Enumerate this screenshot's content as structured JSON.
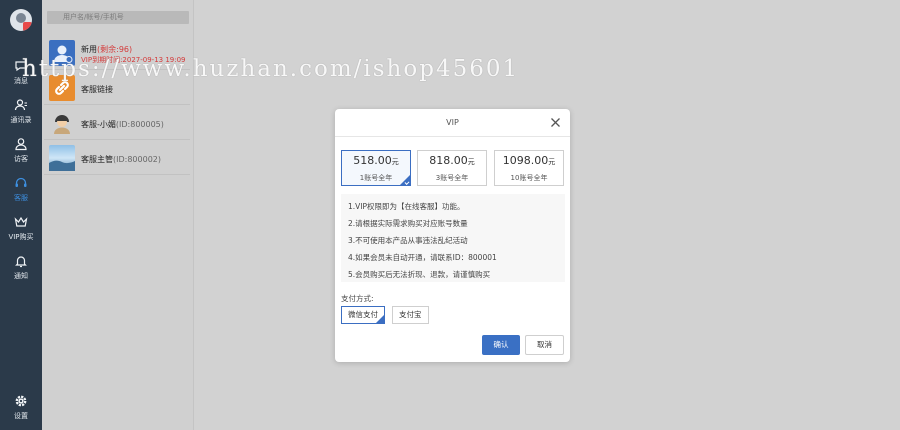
{
  "nav": {
    "items": [
      {
        "label": "消息",
        "icon": "chat-icon"
      },
      {
        "label": "通讯录",
        "icon": "contacts-icon"
      },
      {
        "label": "访客",
        "icon": "visitor-icon"
      },
      {
        "label": "客服",
        "icon": "headset-icon"
      },
      {
        "label": "VIP购买",
        "icon": "crown-icon"
      },
      {
        "label": "通知",
        "icon": "bell-icon"
      }
    ],
    "settings_label": "设置",
    "active_color": "#3d8fe0"
  },
  "search": {
    "placeholder": "用户名/帐号/手机号"
  },
  "contacts": [
    {
      "name": "新用",
      "name_extra": "(剩余:96)",
      "sub": "VIP到期时间:2027-09-13 19:09"
    },
    {
      "name": "客服链接",
      "name_extra": "",
      "sub": ""
    },
    {
      "name": "客服-小媚",
      "name_extra": "(ID:800005)",
      "sub": ""
    },
    {
      "name": "客服主管",
      "name_extra": "(ID:800002)",
      "sub": ""
    }
  ],
  "watermark": "https://www.huzhan.com/ishop45601",
  "modal": {
    "title": "VIP",
    "plans": [
      {
        "price": "518.00",
        "unit": "元",
        "desc": "1账号全年",
        "selected": true
      },
      {
        "price": "818.00",
        "unit": "元",
        "desc": "3账号全年",
        "selected": false
      },
      {
        "price": "1098.00",
        "unit": "元",
        "desc": "10账号全年",
        "selected": false
      }
    ],
    "rules": [
      "1.VIP权限即为【在线客服】功能。",
      "2.请根据实际需求购买对应账号数量",
      "3.不可使用本产品从事违法乱纪活动",
      "4.如果会员未自动开通，请联系ID：800001",
      "5.会员购买后无法折现、退款，请谨慎购买"
    ],
    "pay_label": "支付方式:",
    "pay_methods": [
      {
        "label": "微信支付",
        "selected": true
      },
      {
        "label": "支付宝",
        "selected": false
      }
    ],
    "confirm_label": "确认",
    "cancel_label": "取消",
    "accent_color": "#3a70c4"
  }
}
